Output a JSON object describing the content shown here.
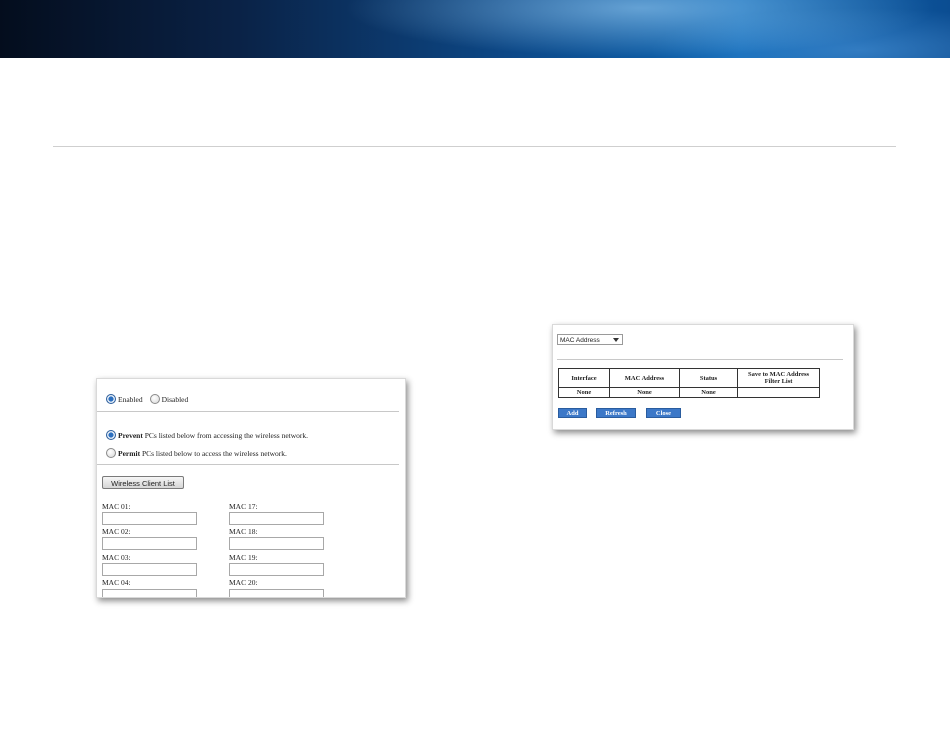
{
  "left_panel": {
    "status": {
      "enabled_label": "Enabled",
      "disabled_label": "Disabled",
      "selected": "Enabled"
    },
    "prevent": {
      "bold": "Prevent",
      "rest": " PCs listed below from accessing the wireless network."
    },
    "permit": {
      "bold": "Permit",
      "rest": " PCs listed below to access the wireless network."
    },
    "client_list_button": "Wireless Client List",
    "mac_fields": [
      {
        "label": "MAC 01:",
        "value": ""
      },
      {
        "label": "MAC 02:",
        "value": ""
      },
      {
        "label": "MAC 03:",
        "value": ""
      },
      {
        "label": "MAC 04:",
        "value": ""
      },
      {
        "label": "MAC 17:",
        "value": ""
      },
      {
        "label": "MAC 18:",
        "value": ""
      },
      {
        "label": "MAC 19:",
        "value": ""
      },
      {
        "label": "MAC 20:",
        "value": ""
      }
    ]
  },
  "right_panel": {
    "select_value": "MAC Address",
    "table": {
      "headers": [
        "Interface",
        "MAC Address",
        "Status",
        "Save to MAC Address Filter List"
      ],
      "rows": [
        [
          "None",
          "None",
          "None",
          ""
        ]
      ]
    },
    "buttons": {
      "add": "Add",
      "refresh": "Refresh",
      "close": "Close"
    }
  },
  "colors": {
    "banner_dark": "#040d1d",
    "banner_blue": "#0f67b4",
    "button_blue": "#3c78c8"
  }
}
